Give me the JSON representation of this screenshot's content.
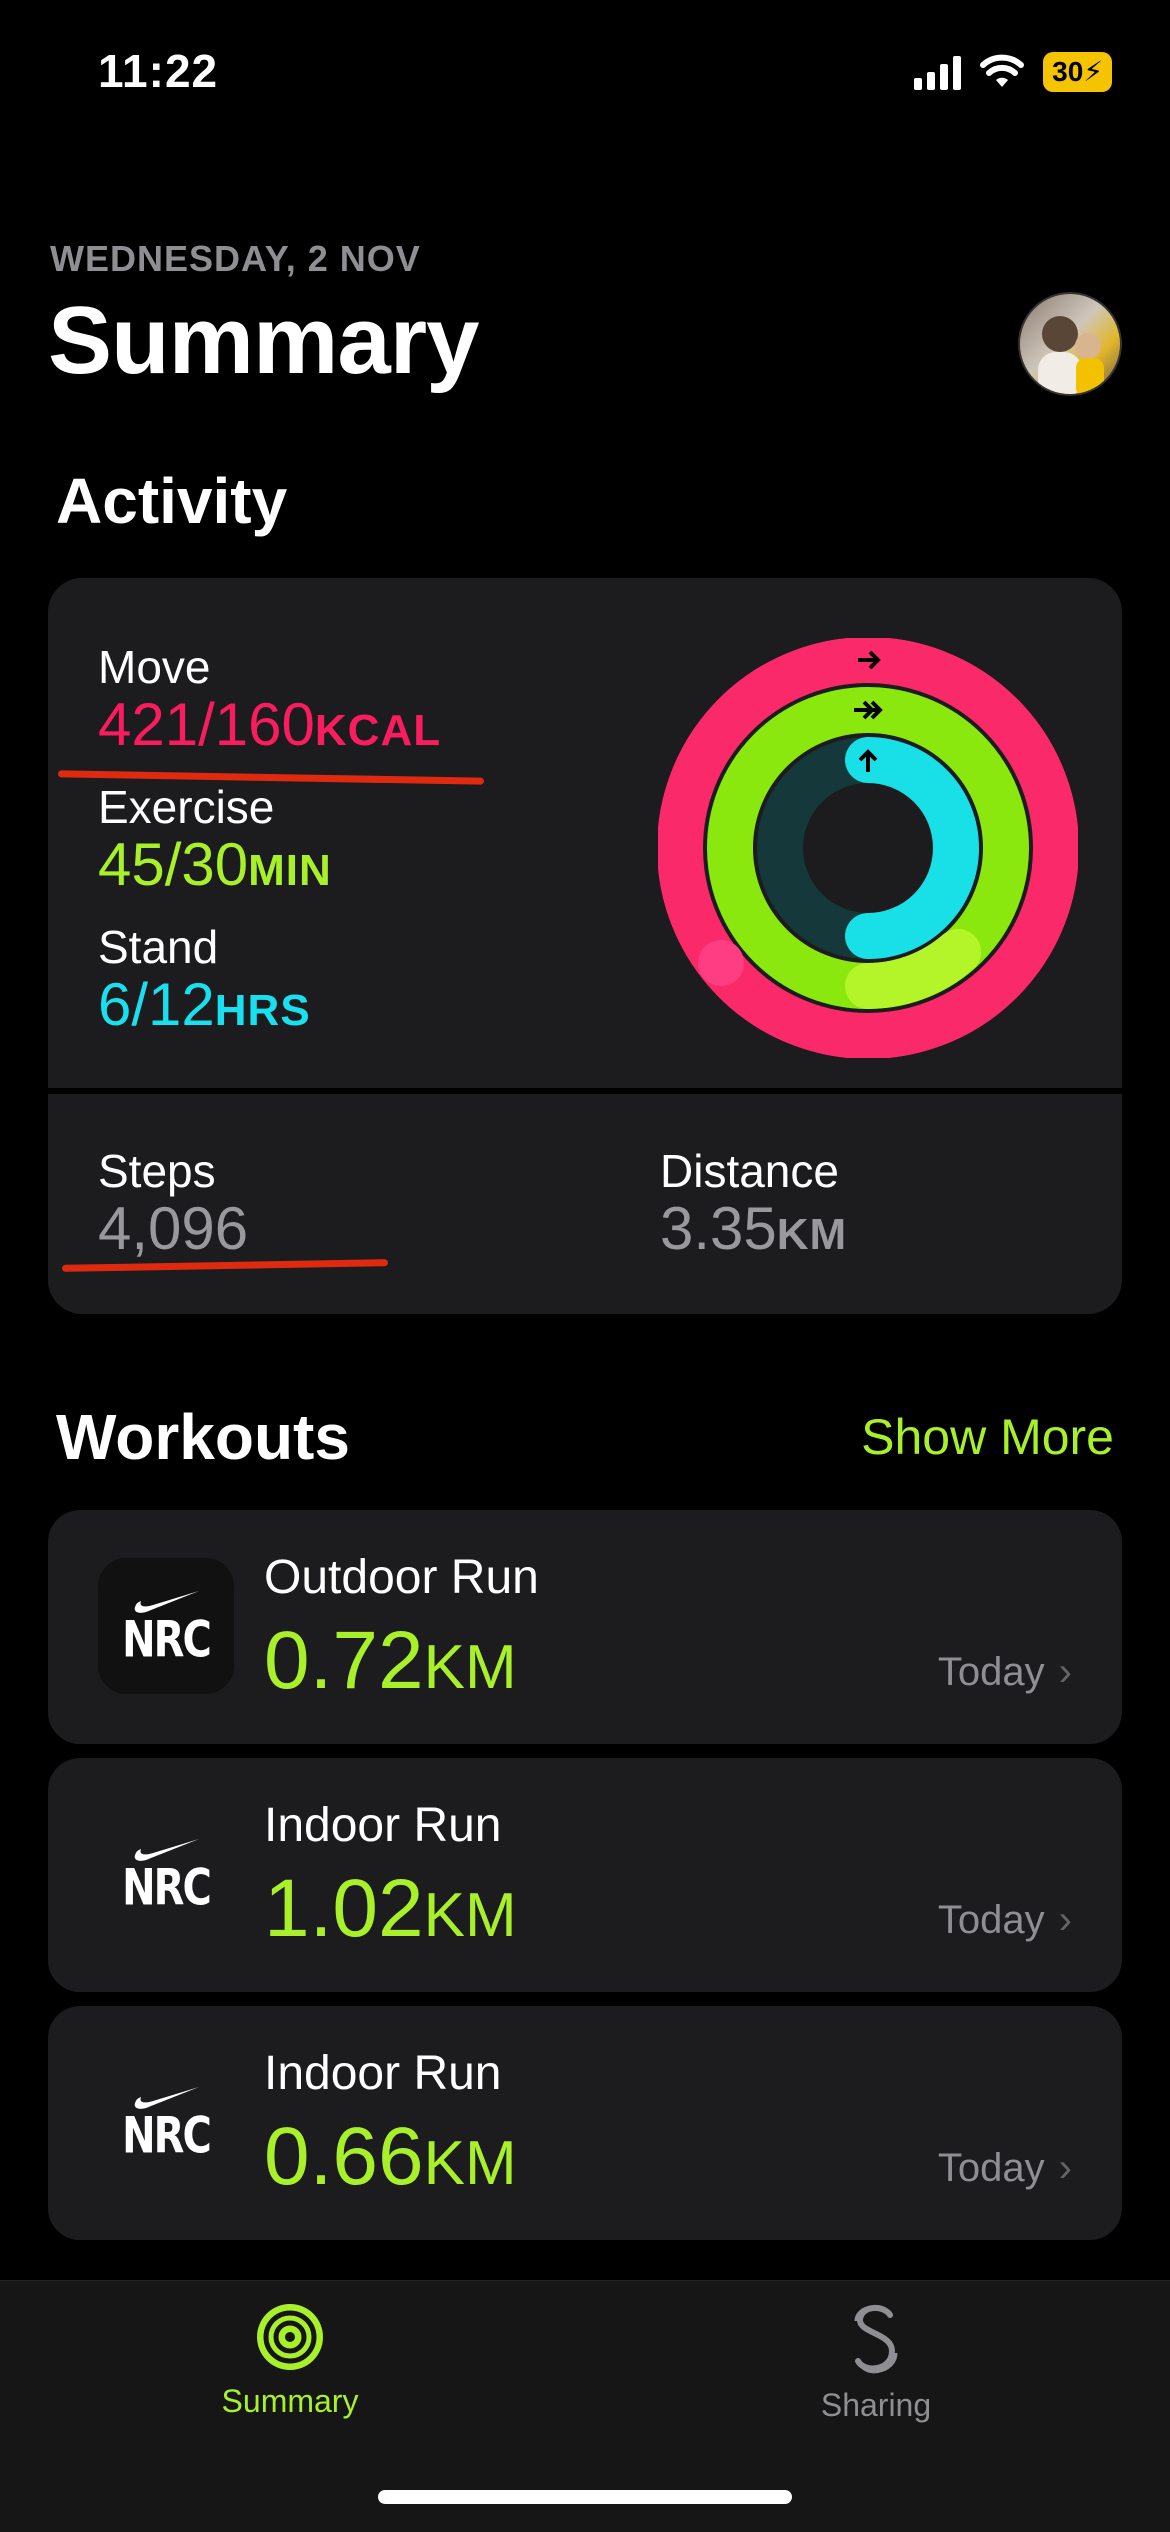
{
  "status_bar": {
    "time": "11:22",
    "battery": "30"
  },
  "header": {
    "date": "WEDNESDAY, 2 NOV",
    "title": "Summary"
  },
  "activity": {
    "section_title": "Activity",
    "move": {
      "label": "Move",
      "value": "421/160",
      "unit": "KCAL",
      "color": "#fa1c5e"
    },
    "exercise": {
      "label": "Exercise",
      "value": "45/30",
      "unit": "MIN",
      "color": "#a8f12a"
    },
    "stand": {
      "label": "Stand",
      "value": "6/12",
      "unit": "HRS",
      "color": "#19e0ee"
    },
    "rings": {
      "move_progress": 2.63,
      "exercise_progress": 1.5,
      "stand_progress": 0.5
    },
    "steps": {
      "label": "Steps",
      "value": "4,096"
    },
    "distance": {
      "label": "Distance",
      "value": "3.35",
      "unit": "KM"
    }
  },
  "workouts": {
    "section_title": "Workouts",
    "show_more": "Show More",
    "items": [
      {
        "name": "Outdoor Run",
        "value": "0.72",
        "unit": "KM",
        "date": "Today",
        "logo": "NRC"
      },
      {
        "name": "Indoor Run",
        "value": "1.02",
        "unit": "KM",
        "date": "Today",
        "logo": "NRC"
      },
      {
        "name": "Indoor Run",
        "value": "0.66",
        "unit": "KM",
        "date": "Today",
        "logo": "NRC"
      }
    ]
  },
  "tabs": [
    {
      "label": "Summary",
      "icon": "activity-rings-icon",
      "active": true,
      "color": "#a8f12a"
    },
    {
      "label": "Sharing",
      "icon": "sharing-icon",
      "active": false,
      "color": "#8e8e93"
    }
  ]
}
